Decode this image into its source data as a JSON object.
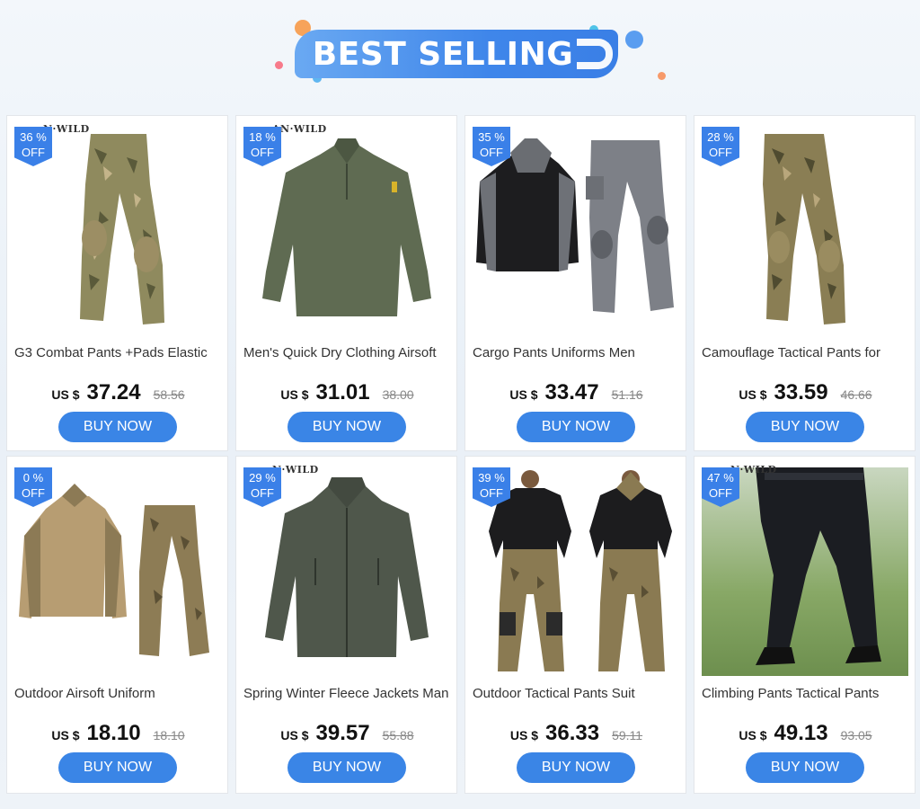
{
  "banner": {
    "title": "BEST SELLING"
  },
  "colors": {
    "accent": "#3a85e6",
    "badge": "#3a80e8"
  },
  "products": [
    {
      "discount": "36 %",
      "off": "OFF",
      "brand": "N·WILD",
      "title": "G3 Combat Pants +Pads Elastic",
      "currency": "US $",
      "price": "37.24",
      "old_price": "58.56",
      "buy": "BUY NOW",
      "image": "camo-pants-icon"
    },
    {
      "discount": "18 %",
      "off": "OFF",
      "brand": "AN·WILD",
      "title": "Men's Quick Dry Clothing Airsoft",
      "currency": "US $",
      "price": "31.01",
      "old_price": "38.00",
      "buy": "BUY NOW",
      "image": "green-shirt-icon"
    },
    {
      "discount": "35 %",
      "off": "OFF",
      "brand": "",
      "title": "Cargo Pants Uniforms Men",
      "currency": "US $",
      "price": "33.47",
      "old_price": "51.16",
      "buy": "BUY NOW",
      "image": "grey-uniform-icon"
    },
    {
      "discount": "28 %",
      "off": "OFF",
      "brand": "",
      "title": "Camouflage Tactical Pants for",
      "currency": "US $",
      "price": "33.59",
      "old_price": "46.66",
      "buy": "BUY NOW",
      "image": "camo-pants-icon"
    },
    {
      "discount": "0 %",
      "off": "OFF",
      "brand": "",
      "title": "Outdoor Airsoft Uniform",
      "currency": "US $",
      "price": "18.10",
      "old_price": "18.10",
      "buy": "BUY NOW",
      "image": "tan-uniform-icon"
    },
    {
      "discount": "29 %",
      "off": "OFF",
      "brand": "N·WILD",
      "title": "Spring Winter Fleece Jackets Man",
      "currency": "US $",
      "price": "39.57",
      "old_price": "55.88",
      "buy": "BUY NOW",
      "image": "fleece-jacket-icon"
    },
    {
      "discount": "39 %",
      "off": "OFF",
      "brand": "",
      "title": "Outdoor Tactical Pants Suit",
      "currency": "US $",
      "price": "36.33",
      "old_price": "59.11",
      "buy": "BUY NOW",
      "image": "camo-suit-icon"
    },
    {
      "discount": "47 %",
      "off": "OFF",
      "brand": "N·WILD",
      "title": "Climbing Pants Tactical Pants",
      "currency": "US $",
      "price": "49.13",
      "old_price": "93.05",
      "buy": "BUY NOW",
      "image": "black-pants-icon"
    }
  ]
}
